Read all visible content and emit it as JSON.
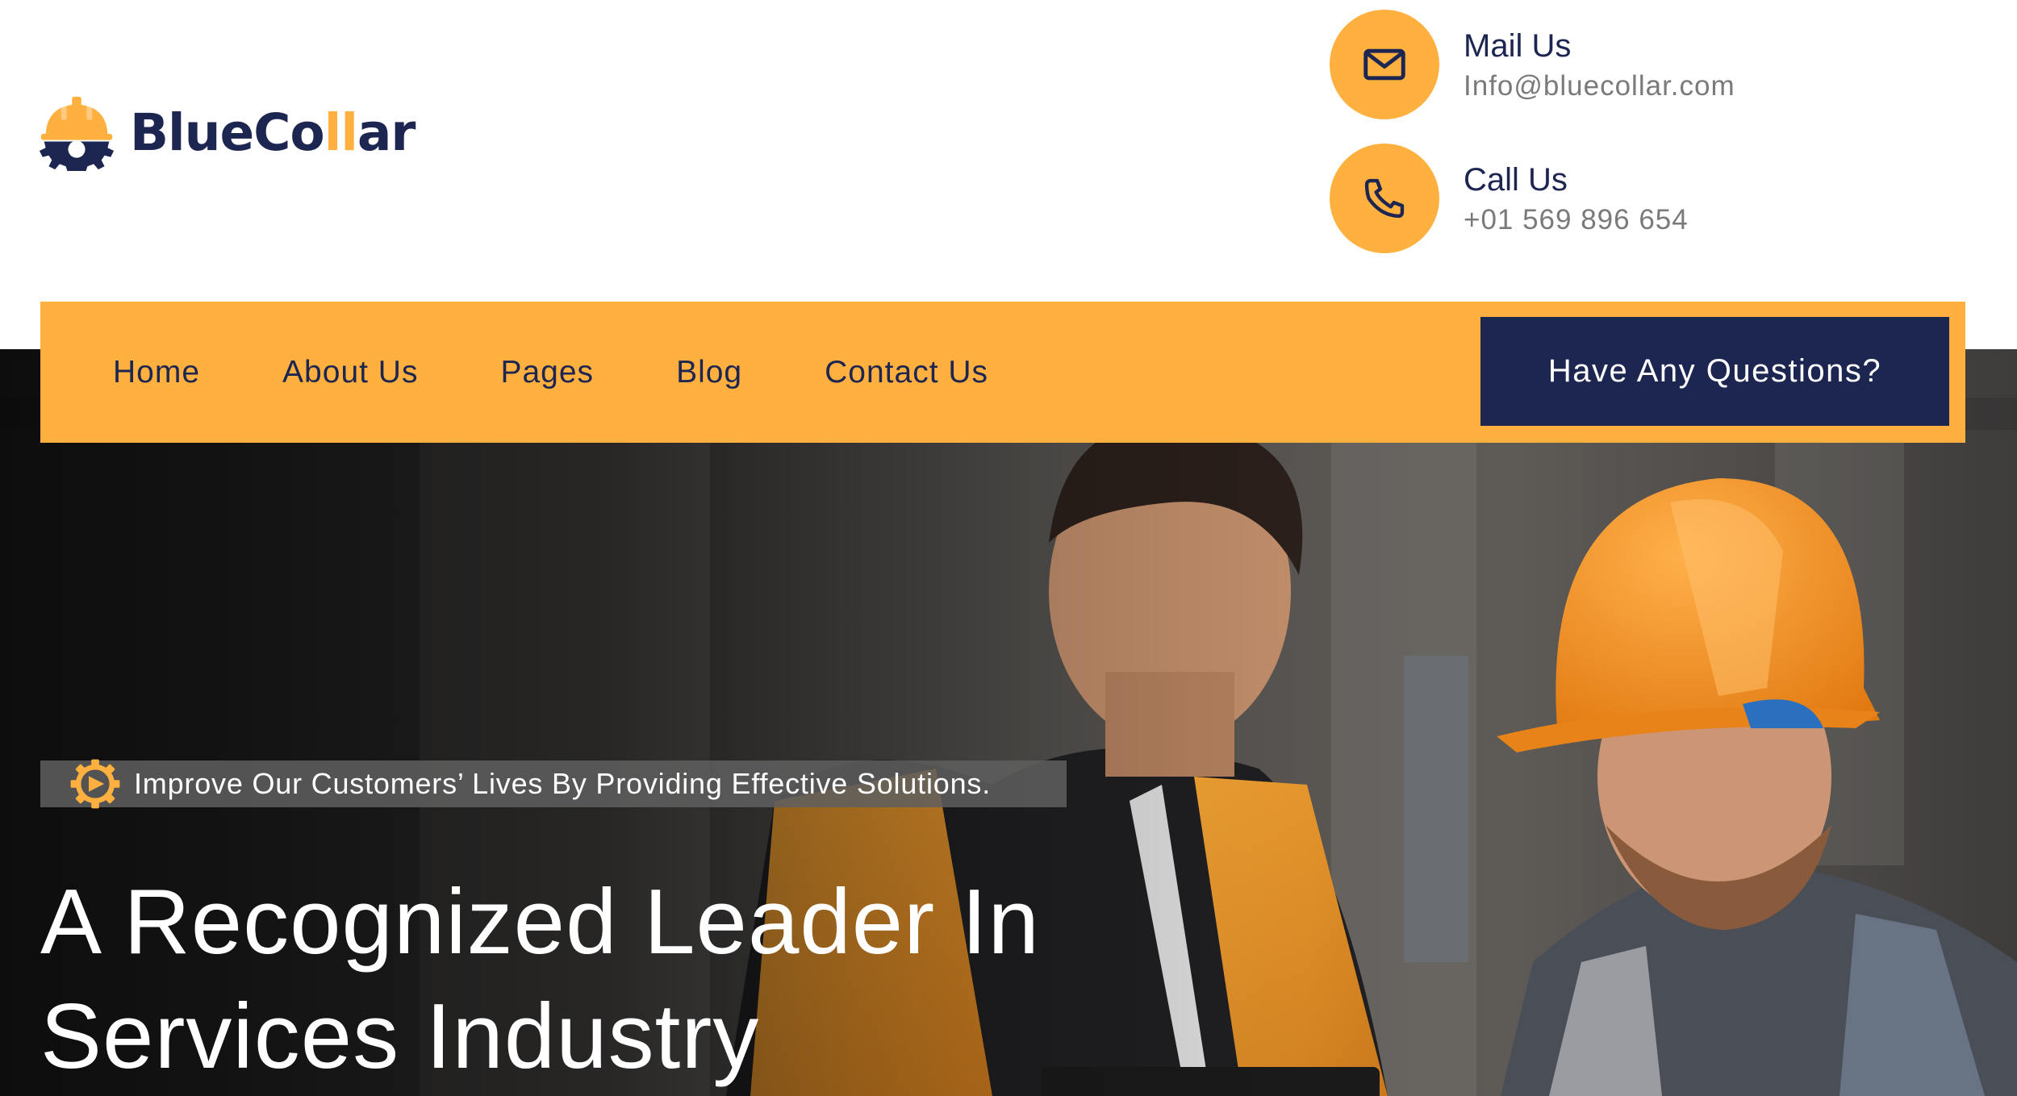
{
  "brand": {
    "name_part1": "BlueCo",
    "name_accent": "ll",
    "name_part2": "ar",
    "logo_icon": "gear-hardhat-icon"
  },
  "contacts": {
    "mail": {
      "title": "Mail Us",
      "value": "Info@bluecollar.com",
      "icon": "envelope-icon"
    },
    "call": {
      "title": "Call Us",
      "value": "+01 569 896 654",
      "icon": "phone-icon"
    }
  },
  "nav": {
    "items": [
      {
        "label": "Home"
      },
      {
        "label": "About Us"
      },
      {
        "label": "Pages"
      },
      {
        "label": "Blog"
      },
      {
        "label": "Contact Us"
      }
    ],
    "cta_label": "Have Any Questions?"
  },
  "hero": {
    "tagline": "Improve Our Customers’ Lives By Providing Effective Solutions.",
    "tagline_icon": "gear-icon",
    "title_line1": "A Recognized Leader In",
    "title_line2": "Services Industry",
    "image_icon": "two-workers-hardhat-photo"
  },
  "colors": {
    "accent": "#ffb03f",
    "navy": "#1d2551",
    "muted": "#7a7a7a",
    "white": "#ffffff"
  }
}
